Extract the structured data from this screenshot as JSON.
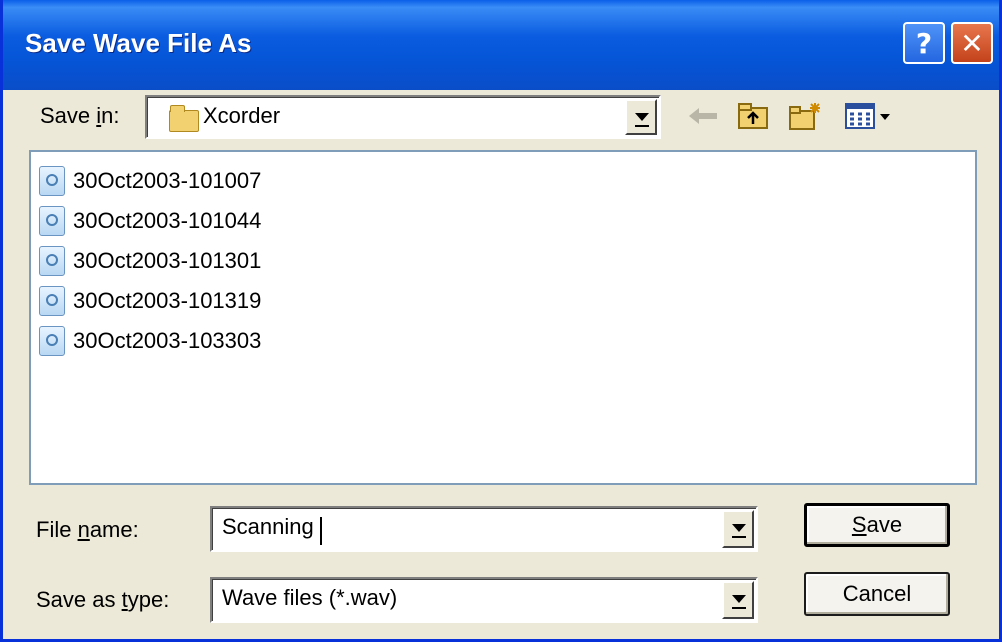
{
  "window": {
    "title": "Save Wave File As",
    "help_label": "?",
    "close_label": "✕"
  },
  "save_in": {
    "label_pre": "Save ",
    "label_u": "i",
    "label_post": "n:",
    "folder": "Xcorder"
  },
  "toolbar": {
    "back_icon": "back-arrow-icon",
    "up_icon": "up-folder-icon",
    "new_folder_icon": "new-folder-icon",
    "view_menu_icon": "view-menu-icon"
  },
  "files": [
    "30Oct2003-101007",
    "30Oct2003-101044",
    "30Oct2003-101301",
    "30Oct2003-101319",
    "30Oct2003-103303"
  ],
  "file_name": {
    "label_pre": "File ",
    "label_u": "n",
    "label_post": "ame:",
    "value": "Scanning"
  },
  "save_as_type": {
    "label_pre": "Save as ",
    "label_u": "t",
    "label_post": "ype:",
    "value": "Wave files (*.wav)"
  },
  "buttons": {
    "save_u": "S",
    "save_rest": "ave",
    "cancel": "Cancel"
  },
  "colors": {
    "title_bar": "#0a5fe8",
    "face": "#ece9d8",
    "close": "#c3421b"
  }
}
